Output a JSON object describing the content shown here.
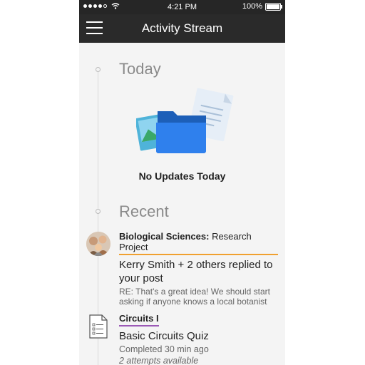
{
  "status_bar": {
    "time": "4:21 PM",
    "battery": "100%"
  },
  "navbar": {
    "title": "Activity Stream"
  },
  "today": {
    "heading": "Today",
    "empty_message": "No Updates Today"
  },
  "recent": {
    "heading": "Recent",
    "items": [
      {
        "course_name": "Biological Sciences:",
        "course_context": "Research Project",
        "headline": "Kerry Smith + 2 others replied to your post",
        "snippet": "RE: That's a great idea! We should start asking if anyone knows a local botanist"
      },
      {
        "course_name": "Circuits I",
        "headline": "Basic Circuits Quiz",
        "meta": "Completed 30 min ago",
        "meta2": "2 attempts available"
      }
    ]
  },
  "colors": {
    "navbar": "#2a2a2a",
    "accent_orange": "#f0a030",
    "accent_purple": "#9b59b6",
    "folder_blue": "#2f80ed"
  }
}
